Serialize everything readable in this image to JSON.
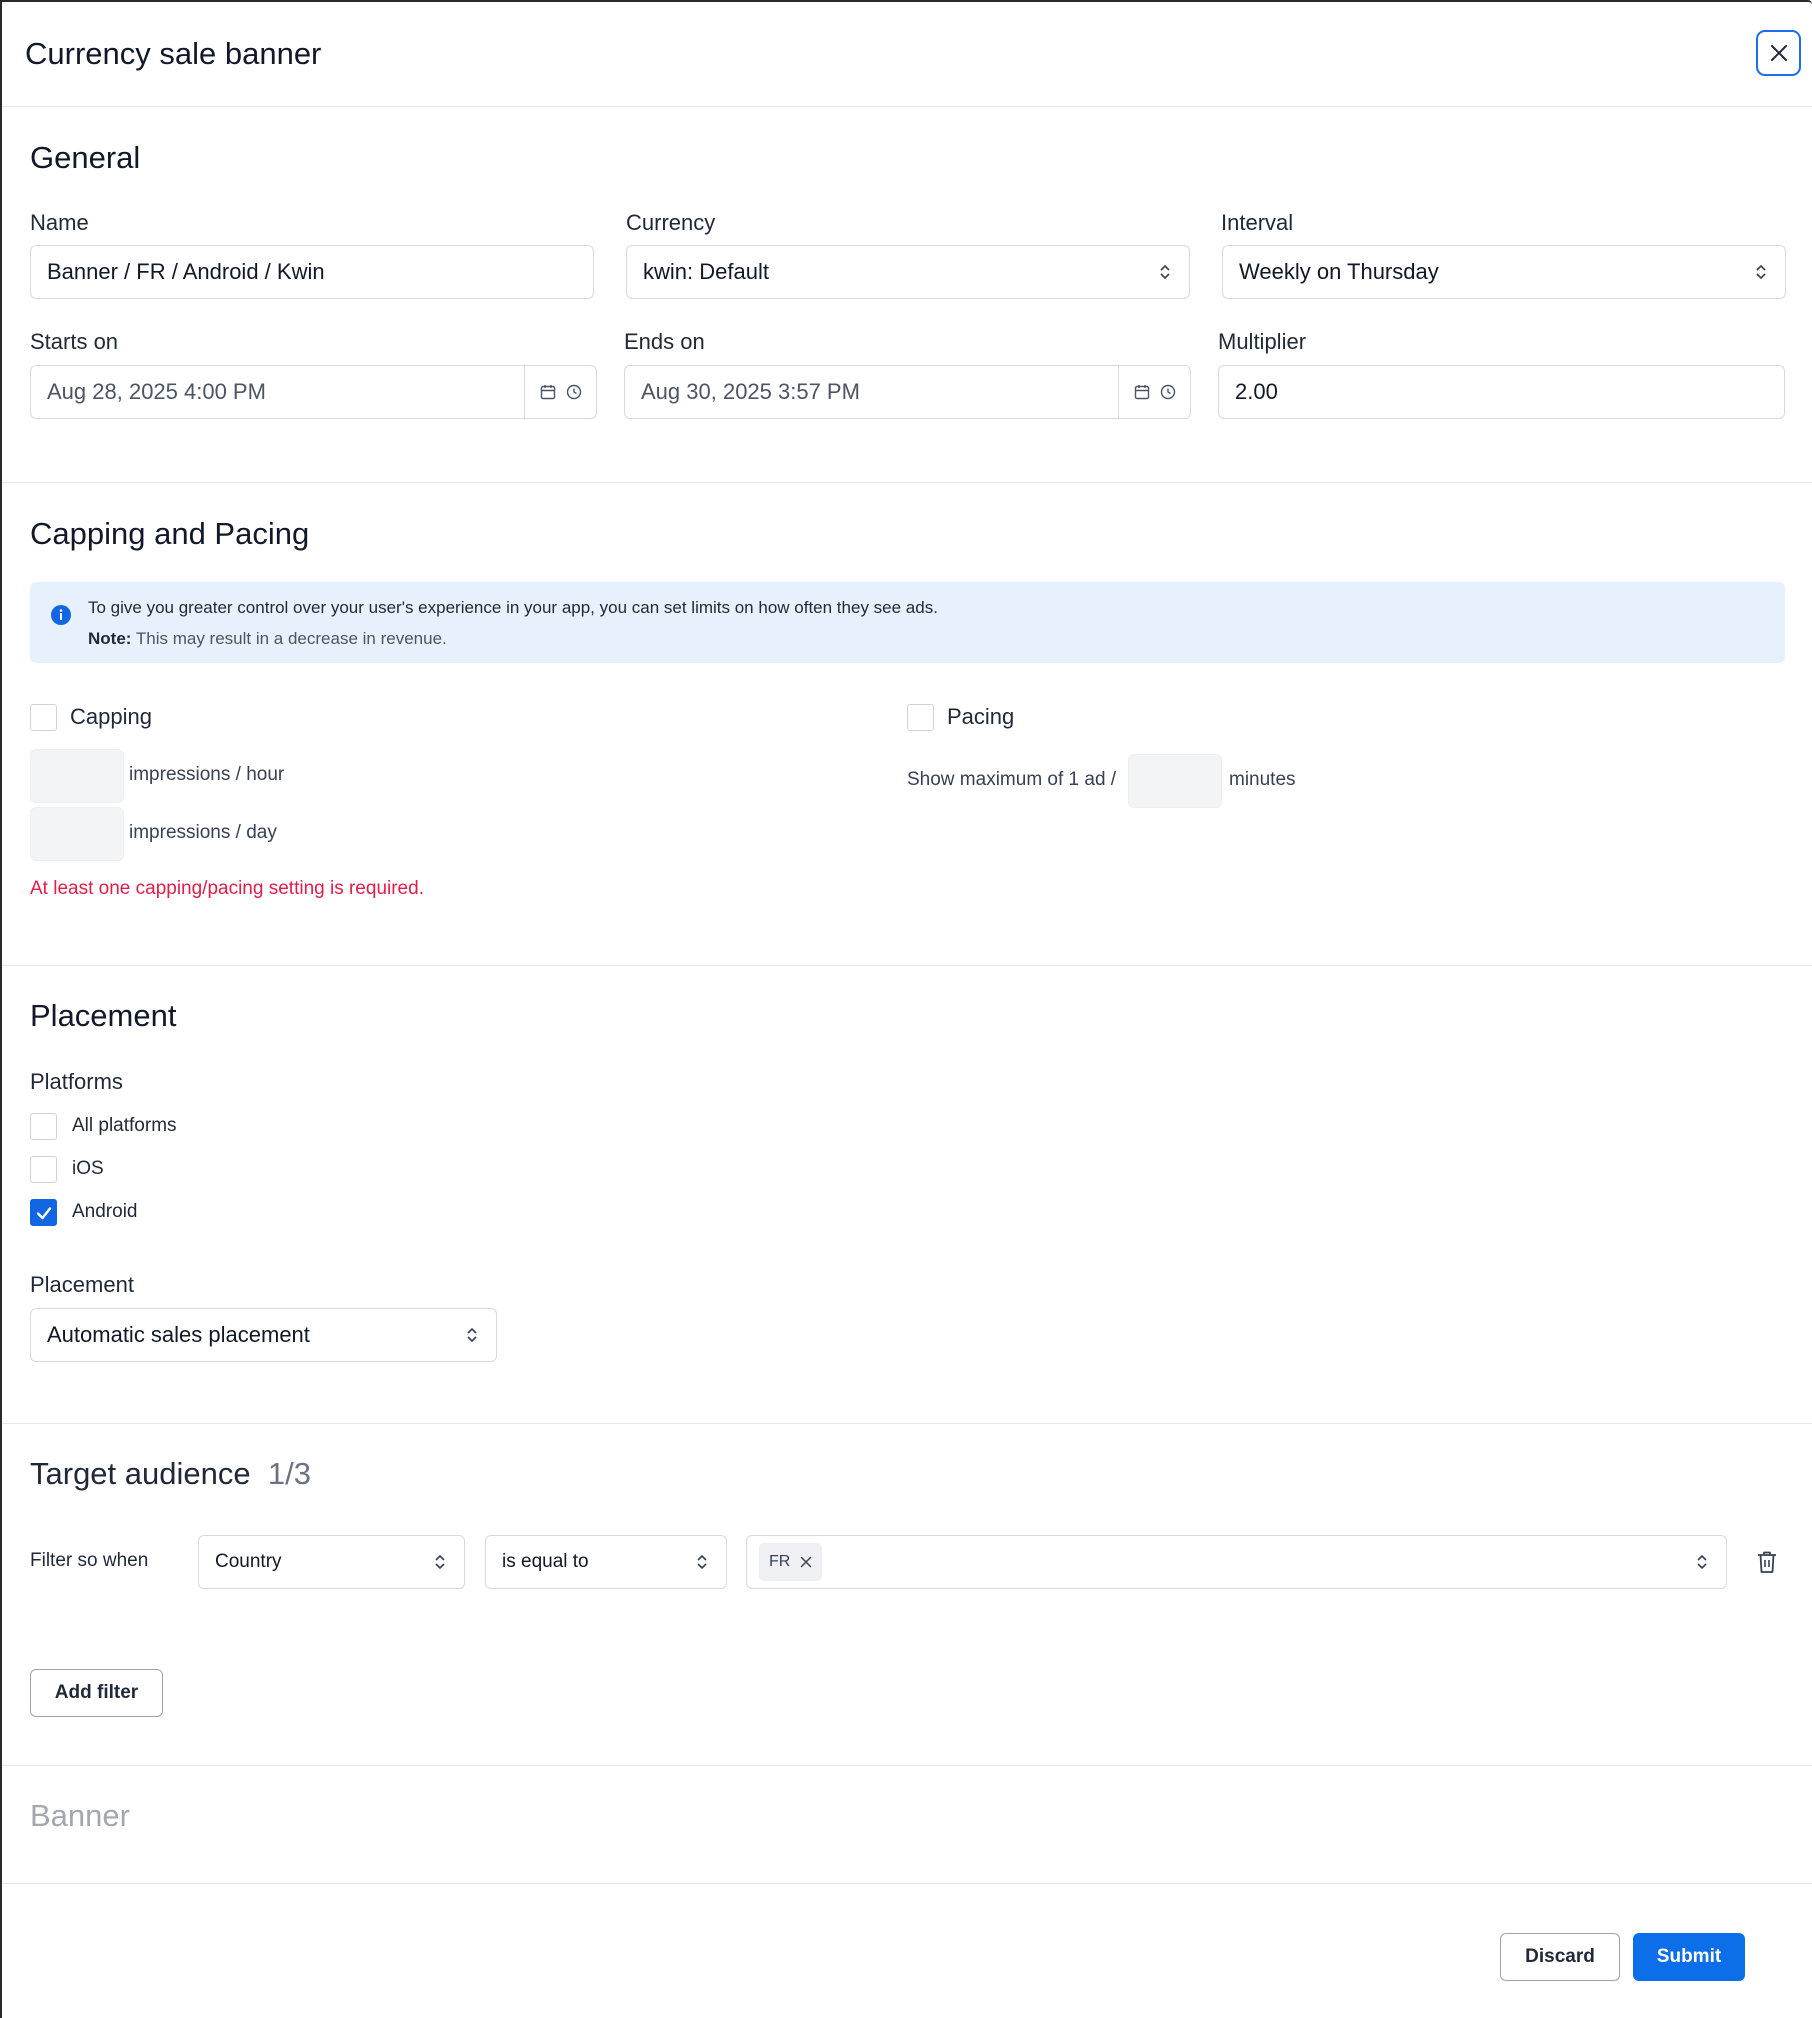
{
  "dialog": {
    "title": "Currency sale banner"
  },
  "general": {
    "title": "General",
    "name_label": "Name",
    "name_value": "Banner / FR / Android / Kwin",
    "currency_label": "Currency",
    "currency_value": "kwin: Default",
    "interval_label": "Interval",
    "interval_value": "Weekly on Thursday",
    "starts_label": "Starts on",
    "starts_value": "Aug 28, 2025 4:00 PM",
    "ends_label": "Ends on",
    "ends_value": "Aug 30, 2025 3:57 PM",
    "multiplier_label": "Multiplier",
    "multiplier_value": "2.00"
  },
  "capping": {
    "title": "Capping and Pacing",
    "info_text": "To give you greater control over your user's experience in your app, you can set limits on how often they see ads.",
    "info_note_label": "Note:",
    "info_note_text": "This may result in a decrease in revenue.",
    "capping_label": "Capping",
    "per_hour": "impressions / hour",
    "per_day": "impressions / day",
    "pacing_label": "Pacing",
    "pacing_prefix": "Show maximum of 1 ad /",
    "pacing_suffix": "minutes",
    "error": "At least one capping/pacing setting is required.",
    "capping_checked": false,
    "pacing_checked": false
  },
  "placement": {
    "title": "Placement",
    "platforms_label": "Platforms",
    "platforms": [
      {
        "label": "All platforms",
        "checked": false
      },
      {
        "label": "iOS",
        "checked": false
      },
      {
        "label": "Android",
        "checked": true
      }
    ],
    "placement_label": "Placement",
    "placement_value": "Automatic sales placement"
  },
  "audience": {
    "title": "Target audience",
    "count": "1/3",
    "filter_prefix": "Filter so when",
    "field_value": "Country",
    "operator_value": "is equal to",
    "tags": [
      "FR"
    ],
    "add_filter": "Add filter"
  },
  "banner": {
    "title": "Banner"
  },
  "footer": {
    "discard": "Discard",
    "submit": "Submit"
  },
  "colors": {
    "primary": "#0d6ee9",
    "error": "#e11d48",
    "info_bg": "#e6f1fd"
  }
}
